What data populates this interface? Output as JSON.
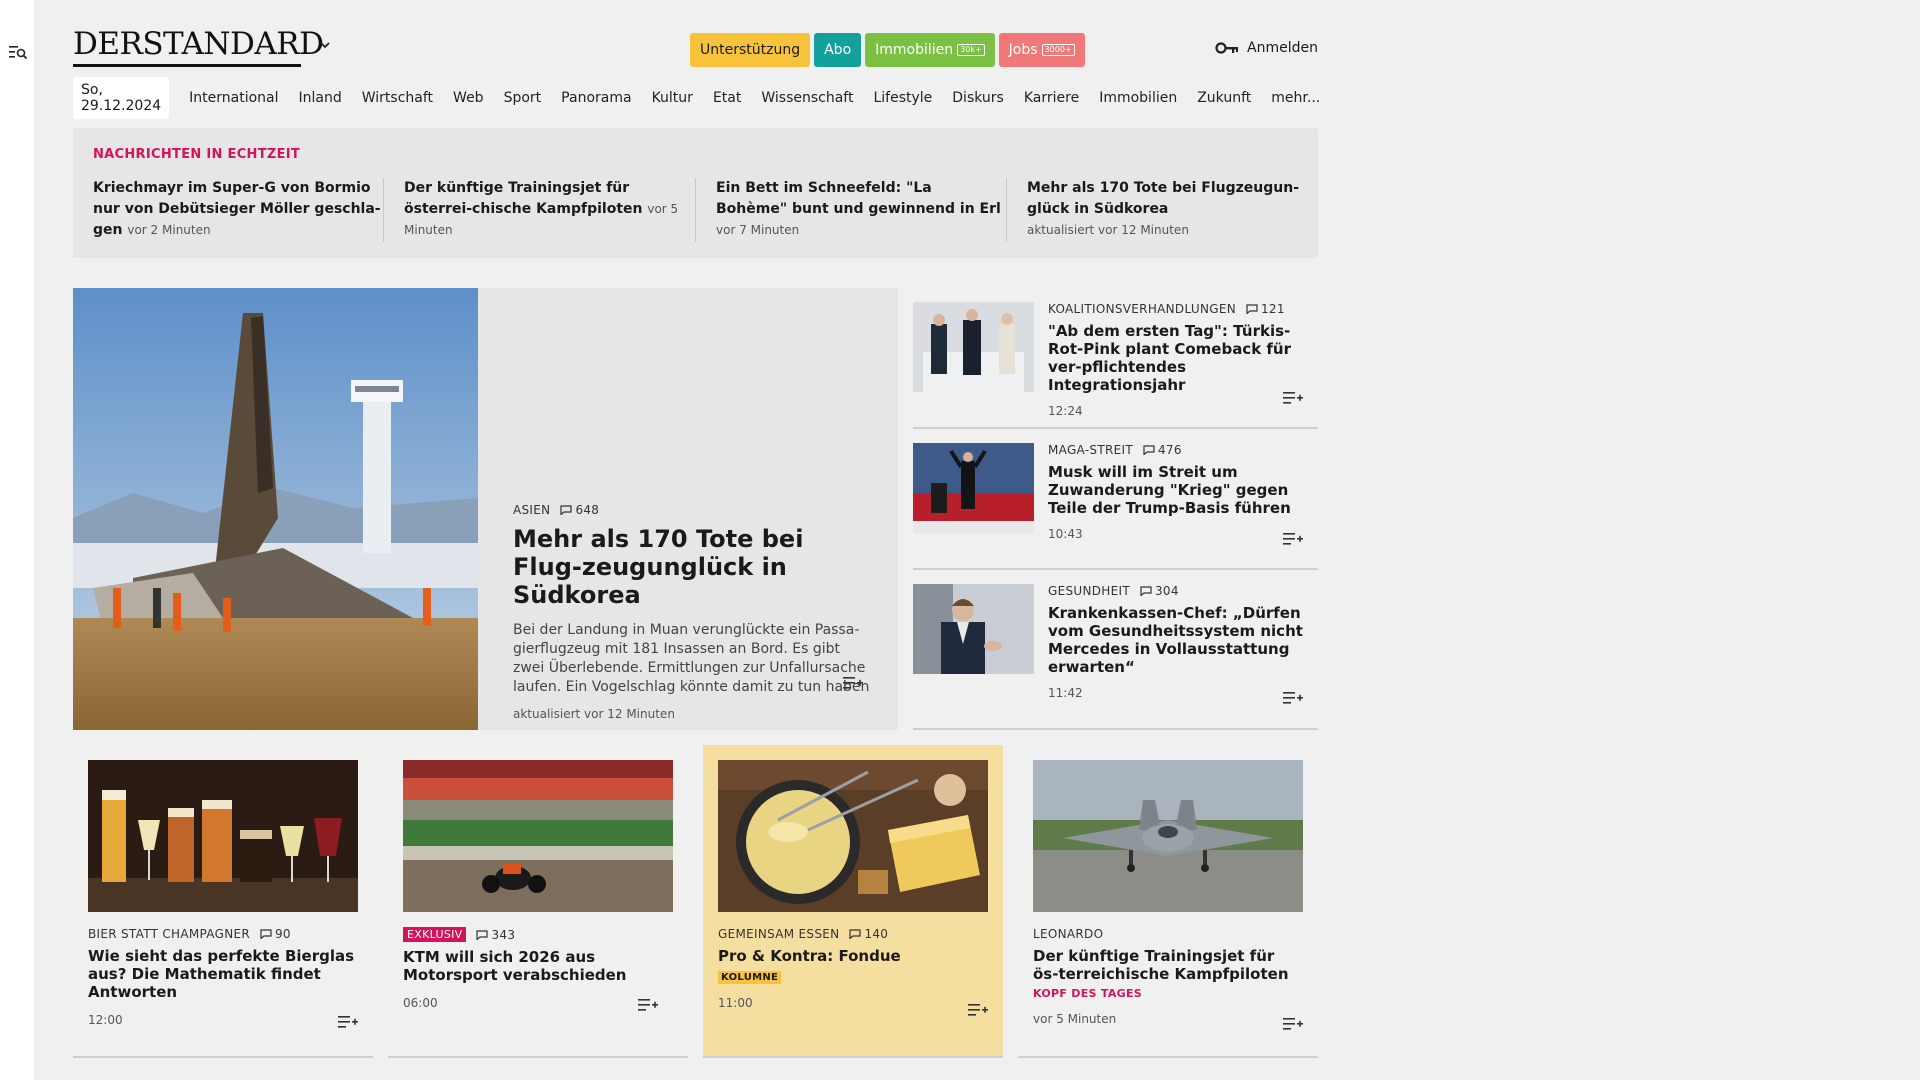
{
  "header": {
    "logo": "DERSTANDARD",
    "buttons": {
      "support": "Unterstützung",
      "abo": "Abo",
      "immobilien": "Immobilien",
      "immobilien_tag": "30k+",
      "jobs": "Jobs",
      "jobs_tag": "3000+"
    },
    "login": "Anmelden"
  },
  "nav": {
    "date": "So, 29.12.2024",
    "items": [
      "International",
      "Inland",
      "Wirtschaft",
      "Web",
      "Sport",
      "Panorama",
      "Kultur",
      "Etat",
      "Wissenschaft",
      "Lifestyle",
      "Diskurs",
      "Karriere",
      "Immobilien",
      "Zukunft",
      "mehr..."
    ]
  },
  "ticker": {
    "title": "NACHRICHTEN IN ECHTZEIT",
    "items": [
      {
        "headline": "Kriechmayr im Super-G von Bormio nur von Debütsieger Möller geschla-gen",
        "time": "vor 2 Minuten"
      },
      {
        "headline": "Der künftige Trainingsjet für österrei-chische Kampfpiloten",
        "time": "vor 5 Minuten"
      },
      {
        "headline": "Ein Bett im Schneefeld: \"La Bohème\" bunt und gewinnend in Erl",
        "time": "vor 7 Minuten"
      },
      {
        "headline": "Mehr als 170 Tote bei Flugzeugun-glück in Südkorea",
        "time": "aktualisiert vor 12 Minuten"
      }
    ]
  },
  "hero": {
    "kicker": "ASIEN",
    "comments": "648",
    "title": "Mehr als 170 Tote bei Flug-zeugunglück in Südkorea",
    "description": "Bei der Landung in Muan verunglückte ein Passa-gierflugzeug mit 181 Insassen an Bord. Es gibt zwei Überlebende. Ermittlungen zur Unfallursache laufen. Ein Vogelschlag könnte damit zu tun haben",
    "time": "aktualisiert vor 12 Minuten"
  },
  "side": [
    {
      "kicker": "KOALITIONSVERHANDLUNGEN",
      "comments": "121",
      "title": "\"Ab dem ersten Tag\": Türkis-Rot-Pink plant Comeback für ver-pflichtendes Integrationsjahr",
      "time": "12:24"
    },
    {
      "kicker": "MAGA-STREIT",
      "comments": "476",
      "title": "Musk will im Streit um Zuwanderung \"Krieg\" gegen Teile der Trump-Basis führen",
      "time": "10:43"
    },
    {
      "kicker": "GESUNDHEIT",
      "comments": "304",
      "title": "Krankenkassen-Chef: „Dürfen vom Gesundheitssystem nicht Mercedes in Vollausstattung erwarten“",
      "time": "11:42"
    }
  ],
  "cards": [
    {
      "kicker": "BIER STATT CHAMPAGNER",
      "comments": "90",
      "title": "Wie sieht das perfekte Bierglas aus? Die Mathematik findet Antworten",
      "time": "12:00"
    },
    {
      "badge": "EXKLUSIV",
      "comments": "343",
      "title": "KTM will sich 2026 aus Motorsport verabschieden",
      "time": "06:00"
    },
    {
      "kicker": "GEMEINSAM ESSEN",
      "comments": "140",
      "title": "Pro & Kontra: Fondue",
      "badge": "KOLUMNE",
      "time": "11:00"
    },
    {
      "kicker": "LEONARDO",
      "title": "Der künftige Trainingsjet für ös-terreichische Kampfpiloten",
      "badge": "KOPF DES TAGES",
      "time": "vor 5 Minuten"
    }
  ],
  "icons": {
    "sidebar": "menu-search-icon",
    "logo_caret": "chevron-down-icon",
    "login": "key-icon",
    "comments": "comment-icon",
    "save": "add-to-list-icon"
  },
  "colors": {
    "accent": "#d4145a",
    "support": "#f6c33b",
    "abo": "#13a19c",
    "immobilien": "#7ac143",
    "jobs": "#f07878",
    "highlight_card": "#f5dfa0"
  }
}
